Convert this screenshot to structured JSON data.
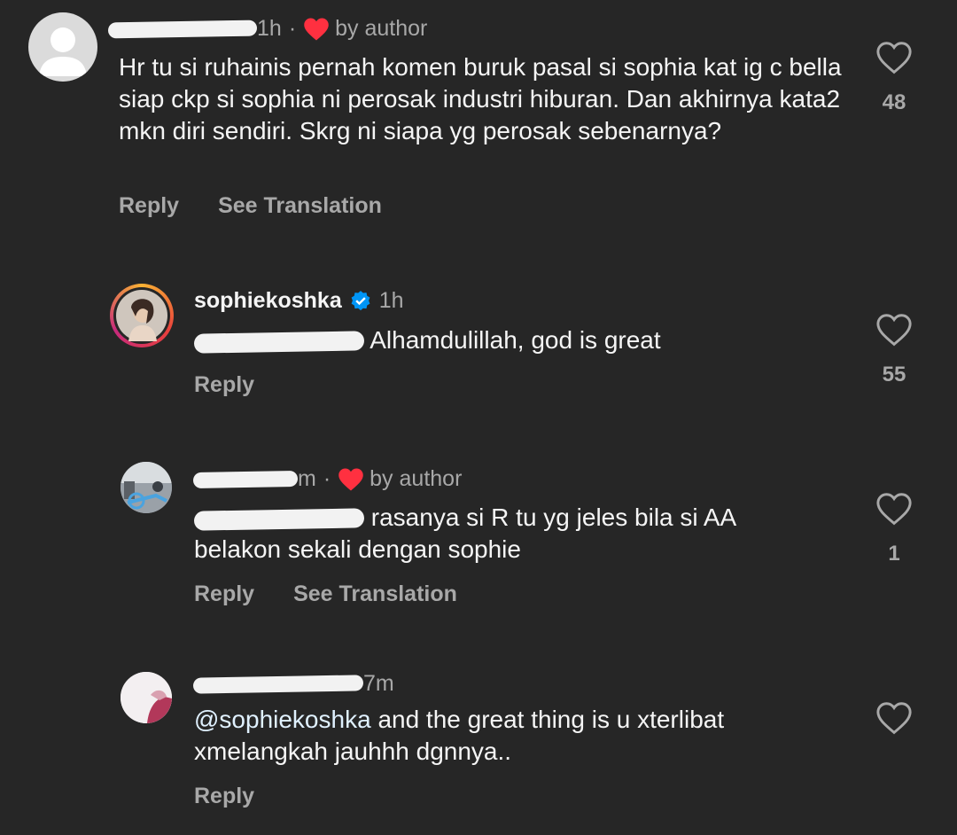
{
  "comments": [
    {
      "time": "1h",
      "author_like_label": "by author",
      "text": "Hr tu si ruhainis pernah komen buruk pasal si sophia kat ig c bella siap ckp si sophia ni perosak industri hiburan. Dan akhirnya kata2 mkn diri sendiri. Skrg ni siapa yg perosak sebenarnya?",
      "reply_label": "Reply",
      "translation_label": "See Translation",
      "like_count": "48"
    },
    {
      "username": "sophiekoshka",
      "time": "1h",
      "text": "Alhamdulillah, god is great",
      "reply_label": "Reply",
      "like_count": "55"
    },
    {
      "time": "m",
      "author_like_label": "by author",
      "text_line1": "rasanya si R tu yg jeles bila si AA",
      "text_line2": "belakon sekali dengan sophie",
      "reply_label": "Reply",
      "translation_label": "See Translation",
      "like_count": "1"
    },
    {
      "time": "7m",
      "mention": "@sophiekoshka",
      "text_line1": "and the great thing is u xterlibat",
      "text_line2": "xmelangkah jauhhh dgnnya..",
      "reply_label": "Reply"
    }
  ],
  "colors": {
    "background": "#262626",
    "text": "#f5f5f5",
    "secondary": "#a8a8a8",
    "heart_red": "#ff3040",
    "verified_blue": "#0095f6"
  },
  "icons": [
    "heart-icon",
    "verified-badge-icon",
    "author-liked-heart-icon"
  ]
}
